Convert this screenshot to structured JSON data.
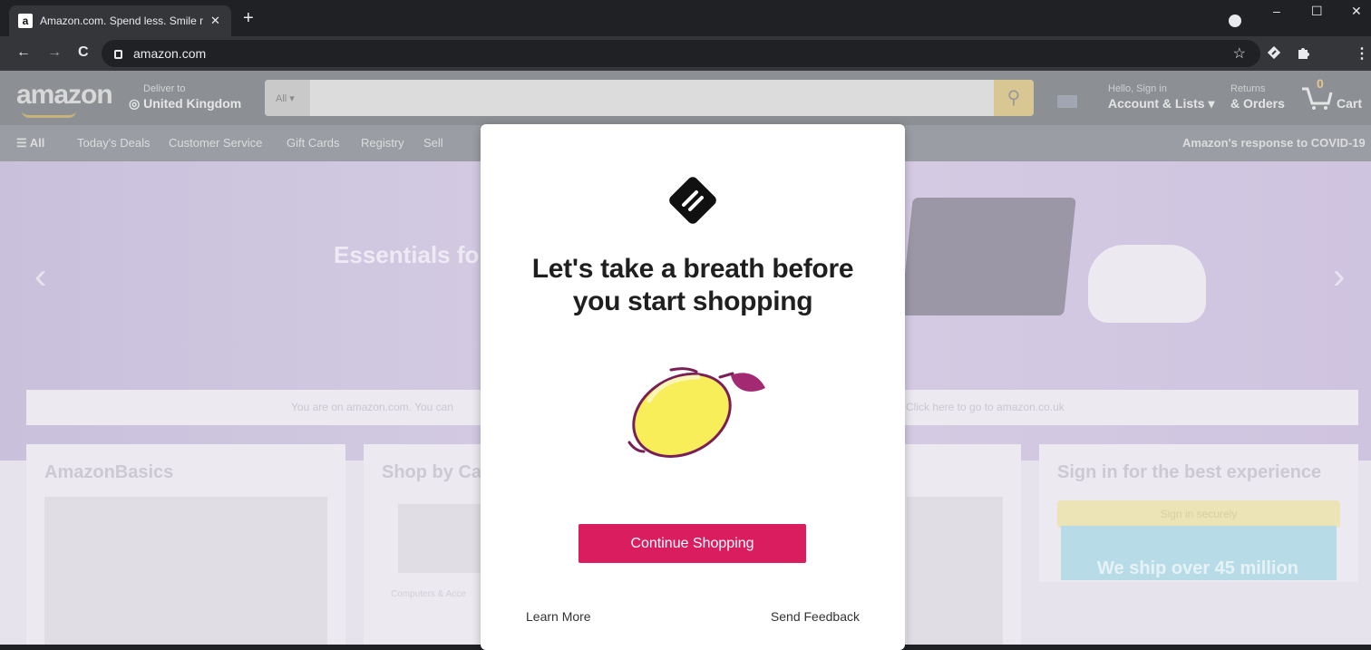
{
  "browser": {
    "tab_title": "Amazon.com. Spend less. Smile more.",
    "tab_close": "✕",
    "new_tab": "+",
    "url": "amazon.com",
    "window_controls": {
      "minimize": "–",
      "maximize": "☐",
      "close": "✕"
    },
    "nav": {
      "back": "←",
      "forward": "→",
      "reload": "C"
    },
    "bookmark_star": "☆",
    "menu": "⋮"
  },
  "amazon": {
    "logo": "amazon",
    "deliver_to": "Deliver to",
    "location": "◎ United Kingdom",
    "search_category": "All ▾",
    "search_icon": "⚲",
    "account_small": "Hello, Sign in",
    "account_big": "Account & Lists ▾",
    "returns_small": "Returns",
    "returns_big": "& Orders",
    "cart_count": "0",
    "cart_label": "Cart",
    "subnav": {
      "all": "☰ All",
      "items": [
        "Today's Deals",
        "Customer Service",
        "Gift Cards",
        "Registry",
        "Sell"
      ],
      "covid": "Amazon's response to COVID-19"
    },
    "hero_title": "Essentials fo",
    "hero_prev": "‹",
    "hero_next": "›",
    "notice_left": "You are on amazon.com. You can",
    "notice_right": "Click here to go to amazon.co.uk",
    "cards": {
      "basics_title": "AmazonBasics",
      "category_title": "Shop by Ca",
      "category_caption": "Computers & Acce",
      "signin_title": "Sign in for the best experience",
      "signin_button": "Sign in securely",
      "ship_text": "We ship over 45 million"
    }
  },
  "modal": {
    "heading_line1": "Let's take a breath before",
    "heading_line2": "you start shopping",
    "continue_button": "Continue Shopping",
    "learn_more": "Learn More",
    "send_feedback": "Send Feedback"
  }
}
